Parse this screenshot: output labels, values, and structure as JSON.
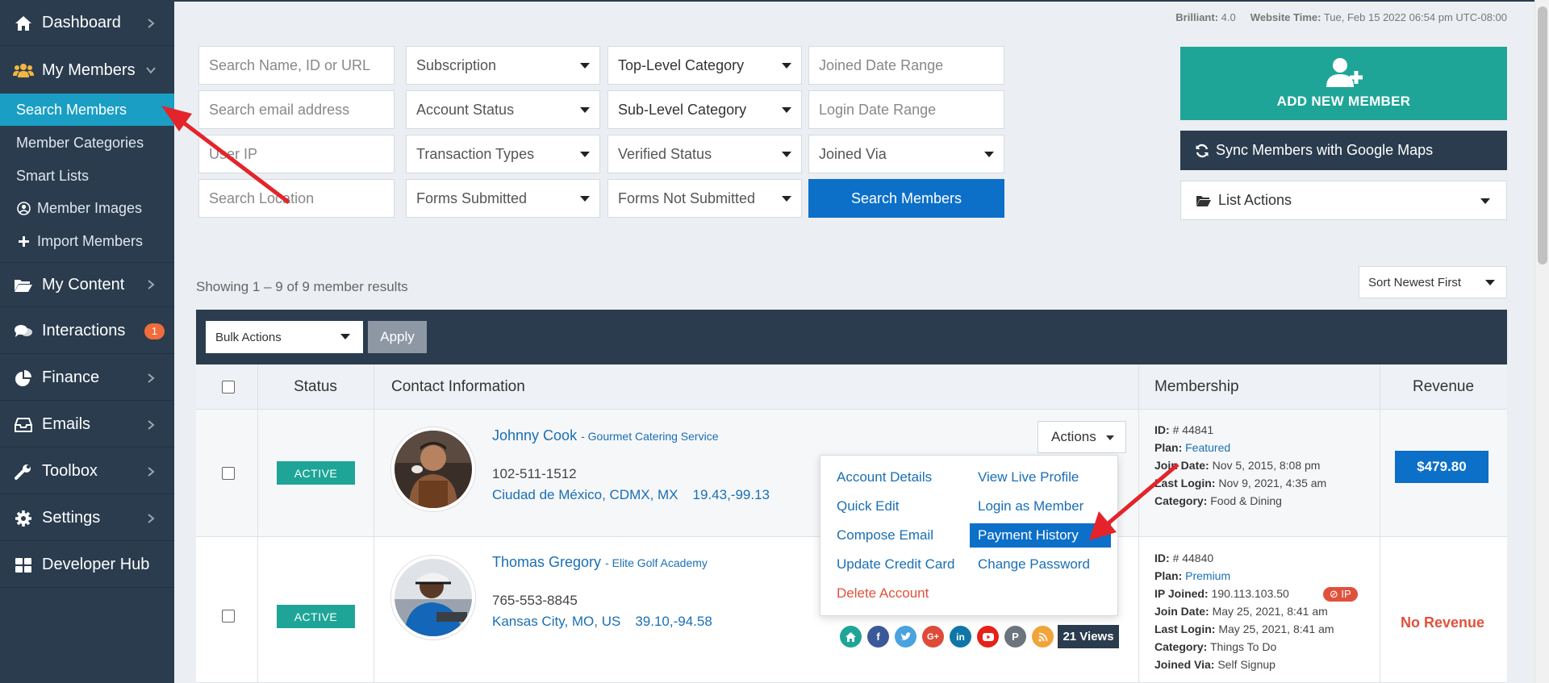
{
  "sidebar": {
    "items": [
      {
        "label": "Dashboard",
        "icon": "dashboard-icon"
      },
      {
        "label": "My Members",
        "icon": "members-icon"
      },
      {
        "label": "My Content",
        "icon": "folder-icon"
      },
      {
        "label": "Interactions",
        "icon": "comments-icon",
        "badge": "1"
      },
      {
        "label": "Finance",
        "icon": "pie-chart-icon"
      },
      {
        "label": "Emails",
        "icon": "inbox-icon"
      },
      {
        "label": "Toolbox",
        "icon": "wrench-icon"
      },
      {
        "label": "Settings",
        "icon": "gear-icon"
      },
      {
        "label": "Developer Hub",
        "icon": "grid-icon"
      }
    ],
    "sub_items": [
      {
        "label": "Search Members",
        "active": true
      },
      {
        "label": "Member Categories"
      },
      {
        "label": "Smart Lists"
      },
      {
        "label": "Member Images",
        "icon": "user-circle-icon"
      },
      {
        "label": "Import Members",
        "icon": "plus-icon"
      }
    ]
  },
  "header": {
    "brilliant_label": "Brilliant:",
    "brilliant_value": "4.0",
    "time_label": "Website Time:",
    "time_value": "Tue, Feb 15 2022 06:54 pm UTC-08:00"
  },
  "filters": {
    "search_name_placeholder": "Search Name, ID or URL",
    "subscription": "Subscription",
    "top_level_category": "Top-Level Category",
    "joined_date_range": "Joined Date Range",
    "search_email_placeholder": "Search email address",
    "account_status": "Account Status",
    "sub_level_category": "Sub-Level Category",
    "login_date_range": "Login Date Range",
    "user_ip_placeholder": "User IP",
    "transaction_types": "Transaction Types",
    "verified_status": "Verified Status",
    "joined_via": "Joined Via",
    "search_location_placeholder": "Search Location",
    "forms_submitted": "Forms Submitted",
    "forms_not_submitted": "Forms Not Submitted",
    "search_button": "Search Members"
  },
  "actions": {
    "add_new_member": "ADD NEW MEMBER",
    "sync_google_maps": "Sync Members with Google Maps",
    "list_actions": "List Actions"
  },
  "results": {
    "showing_text": "Showing 1 – 9 of 9 member results",
    "sort": "Sort Newest First",
    "bulk_actions": "Bulk Actions",
    "apply": "Apply"
  },
  "table": {
    "columns": [
      "Status",
      "Contact Information",
      "Membership",
      "Revenue"
    ],
    "rows": [
      {
        "status": "ACTIVE",
        "name": "Johnny Cook",
        "company": "- Gourmet Catering Service",
        "phone": "102-511-1512",
        "location": "Ciudad de México, CDMX, MX",
        "coords": "19.43,-99.13",
        "actions_label": "Actions",
        "id_label": "ID:",
        "id_value": "# 44841",
        "plan_label": "Plan:",
        "plan_value": "Featured",
        "join_label": "Join Date:",
        "join_value": "Nov 5, 2015, 8:08 pm",
        "login_label": "Last Login:",
        "login_value": "Nov 9, 2021, 4:35 am",
        "category_label": "Category:",
        "category_value": "Food & Dining",
        "revenue": "$479.80"
      },
      {
        "status": "ACTIVE",
        "name": "Thomas Gregory",
        "company": "- Elite Golf Academy",
        "phone": "765-553-8845",
        "location": "Kansas City, MO, US",
        "coords": "39.10,-94.58",
        "views": "21 Views",
        "id_label": "ID:",
        "id_value": "# 44840",
        "plan_label": "Plan:",
        "plan_value": "Premium",
        "ip_label": "IP Joined:",
        "ip_value": "190.113.103.50",
        "ip_badge": "IP",
        "join_label": "Join Date:",
        "join_value": "May 25, 2021, 8:41 am",
        "login_label": "Last Login:",
        "login_value": "May 25, 2021, 8:41 am",
        "category_label": "Category:",
        "category_value": "Things To Do",
        "via_label": "Joined Via:",
        "via_value": "Self Signup",
        "revenue": "No Revenue"
      }
    ]
  },
  "dropdown_menu": {
    "items": [
      "Account Details",
      "View Live Profile",
      "Quick Edit",
      "Login as Member",
      "Compose Email",
      "Payment History",
      "Update Credit Card",
      "Change Password",
      "Delete Account"
    ]
  },
  "social_icons": [
    "home-icon",
    "facebook-icon",
    "twitter-icon",
    "google-plus-icon",
    "linkedin-icon",
    "youtube-icon",
    "pinterest-icon",
    "rss-icon"
  ],
  "colors": {
    "sidebar_bg": "#2a3c4e",
    "active_nav": "#1a9ec3",
    "primary_blue": "#0c6fc8",
    "teal": "#1fa597",
    "danger": "#e0513c",
    "arrow": "#e3242b"
  }
}
